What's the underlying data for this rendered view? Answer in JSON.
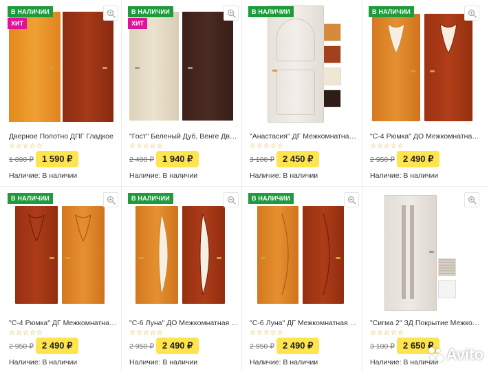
{
  "labels": {
    "in_stock": "В НАЛИЧИИ",
    "hit": "ХИТ",
    "availability": "Наличие: В наличии",
    "stars": "☆☆☆☆☆",
    "watermark": "Avito"
  },
  "products": [
    {
      "title": "Дверное Полотно ДПГ Гладкое",
      "old_price": "1 890 ₽",
      "price": "1 590 ₽",
      "hit": true,
      "in_stock": true
    },
    {
      "title": "\"Гост\" Беленый Дуб, Венге Двер…",
      "old_price": "2 400 ₽",
      "price": "1 940 ₽",
      "hit": true,
      "in_stock": true
    },
    {
      "title": "\"Анастасия\" ДГ Межкомнатная …",
      "old_price": "3 100 ₽",
      "price": "2 450 ₽",
      "hit": false,
      "in_stock": true
    },
    {
      "title": "\"С-4 Рюмка\" ДО Межкомнатная …",
      "old_price": "2 950 ₽",
      "price": "2 490 ₽",
      "hit": false,
      "in_stock": true
    },
    {
      "title": "\"С-4 Рюмка\" ДГ Межкомнатная …",
      "old_price": "2 950 ₽",
      "price": "2 490 ₽",
      "hit": false,
      "in_stock": true
    },
    {
      "title": "\"С-6 Луна\" ДО Межкомнатная Д…",
      "old_price": "2 950 ₽",
      "price": "2 490 ₽",
      "hit": false,
      "in_stock": true
    },
    {
      "title": "\"С-6 Луна\" ДГ Межкомнатная Дв…",
      "old_price": "2 950 ₽",
      "price": "2 490 ₽",
      "hit": false,
      "in_stock": true
    },
    {
      "title": "\"Сигма 2\" ЗД Покрытие Межком…",
      "old_price": "3 100 ₽",
      "price": "2 650 ₽",
      "hit": false,
      "in_stock": false
    }
  ],
  "colors": {
    "stock_badge": "#1e9b3c",
    "hit_badge": "#e0119a",
    "price_bg": "#ffe44d",
    "star": "#e6a300"
  }
}
